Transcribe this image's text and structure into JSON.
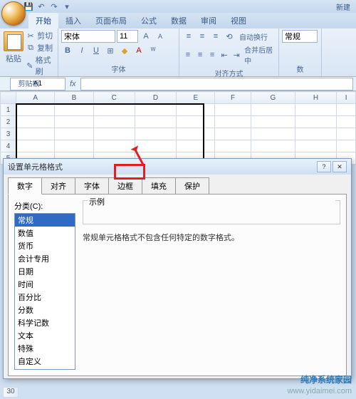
{
  "window": {
    "title_suffix": "新建"
  },
  "qat_icons": [
    "save",
    "undo",
    "redo",
    "print"
  ],
  "ribbon": {
    "tabs": [
      "开始",
      "插入",
      "页面布局",
      "公式",
      "数据",
      "审阅",
      "视图"
    ],
    "active_tab": 0,
    "clipboard": {
      "paste": "粘贴",
      "cut": "剪切",
      "copy": "复制",
      "format": "格式刷",
      "label": "剪贴板"
    },
    "font": {
      "name": "宋体",
      "size": "11",
      "label": "字体"
    },
    "align": {
      "wrap": "自动换行",
      "merge": "合并后居中",
      "label": "对齐方式"
    },
    "number": {
      "format": "常规",
      "label": "数"
    }
  },
  "namebox": "A1",
  "columns": [
    "A",
    "B",
    "C",
    "D",
    "E",
    "F",
    "G",
    "H",
    "I"
  ],
  "rows": [
    "1",
    "2",
    "3",
    "4",
    "5"
  ],
  "selection": {
    "range": "A1:E5"
  },
  "dialog": {
    "title": "设置单元格格式",
    "tabs": [
      "数字",
      "对齐",
      "字体",
      "边框",
      "填充",
      "保护"
    ],
    "active_tab": 0,
    "highlight_tab": 3,
    "category_label": "分类(C):",
    "categories": [
      "常规",
      "数值",
      "货币",
      "会计专用",
      "日期",
      "时间",
      "百分比",
      "分数",
      "科学记数",
      "文本",
      "特殊",
      "自定义"
    ],
    "selected_category": 0,
    "sample_label": "示例",
    "description": "常规单元格格式不包含任何特定的数字格式。"
  },
  "watermark": {
    "brand": "纯净系统家园",
    "url": "www.yidaimei.com"
  },
  "bottom_row": "30"
}
